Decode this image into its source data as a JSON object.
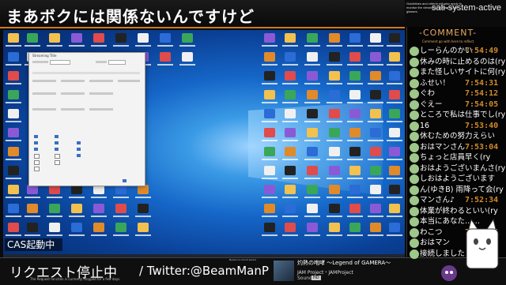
{
  "header": {
    "title": "まあボクには関係ないんですけど",
    "tag": "sati-system-active",
    "note": "Guidelines and criteria will also apply to monitor the viewing by putting up the glasses."
  },
  "desktop": {
    "settings_window_title": "Streaming Title"
  },
  "cas": "CAS起動中",
  "bottom": {
    "request": "リクエスト停止中",
    "request_sub": "The Request function is currently stopped for a few days",
    "twitter": "/ Twitter:@BeamManP",
    "now_playing_header": "Nyaan no mood saved",
    "song_title": "灼熱の咆哮 〜Legend of GAMERA〜",
    "artist": "JAM Project・JAMProject",
    "quality": "HD",
    "source": "Sound"
  },
  "panel": {
    "heading": "-COMMENT-",
    "sub": "Comment go with here to reflect",
    "comments": [
      {
        "text": "しーらんのかい",
        "time": "7:54:49"
      },
      {
        "text": "休みの時に止めるのは(ry",
        "time": ""
      },
      {
        "text": "また怪しいサイトに何(ry",
        "time": ""
      },
      {
        "text": "ふせい！",
        "time": "7:54:31"
      },
      {
        "text": "ぐわ",
        "time": "7:54:12"
      },
      {
        "text": "ぐえー",
        "time": "7:54:05"
      },
      {
        "text": "ところで私は仕事でし(ry",
        "time": ""
      },
      {
        "text": "16",
        "time": "7:53:40"
      },
      {
        "text": "休むための努力えらい",
        "time": ""
      },
      {
        "text": "おはマンさん",
        "time": "7:53:04"
      },
      {
        "text": "ちょっと店員早く(ry",
        "time": ""
      },
      {
        "text": "おはようございまんさ(ry",
        "time": ""
      },
      {
        "text": "しおはようございます",
        "time": ""
      },
      {
        "text": "ん(ゆきB) 雨降って会(ry",
        "time": ""
      },
      {
        "text": "マンさん♪",
        "time": "7:52:34"
      },
      {
        "text": "体業が終わるといい(ry",
        "time": ""
      },
      {
        "text": "本当にあなた……",
        "time": ""
      },
      {
        "text": "わこつ",
        "time": "7:52:05"
      },
      {
        "text": "おはマン",
        "time": ""
      },
      {
        "text": "接続しました",
        "time": ""
      }
    ]
  },
  "colors": {
    "accent": "#d07a1a",
    "comment_time": "#d08a2a"
  }
}
